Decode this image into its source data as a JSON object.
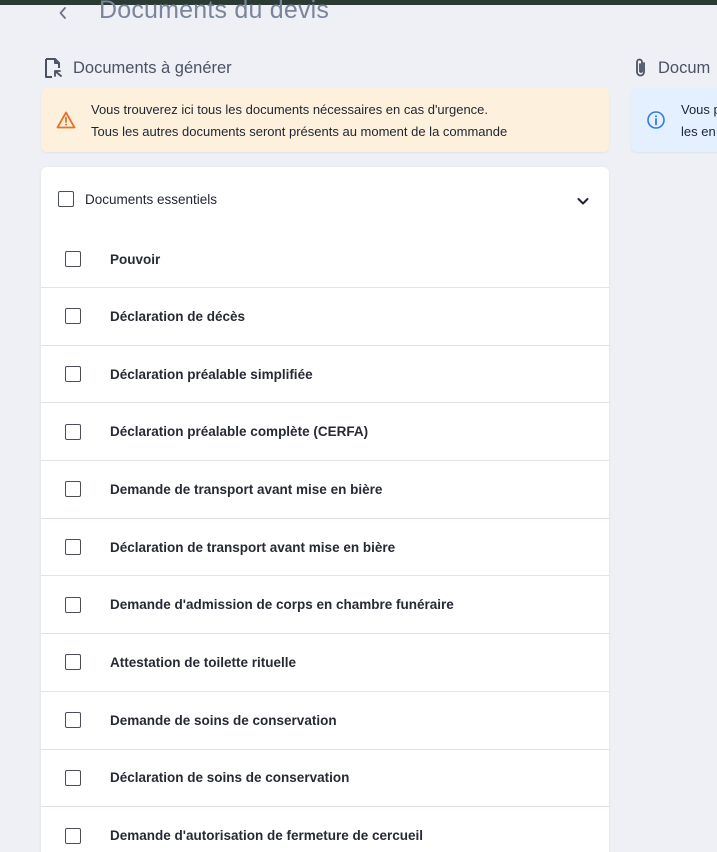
{
  "header": {
    "title": "Documents du devis",
    "back_icon": "chevron-left-icon"
  },
  "sections": {
    "left_title": "Documents à générer",
    "left_icon": "document-generate-icon",
    "right_title": "Docum",
    "right_icon": "paperclip-icon"
  },
  "alerts": {
    "warning": {
      "icon": "warning-triangle-icon",
      "color": "#e8712b",
      "line1": "Vous trouverez ici tous les documents nécessaires en cas d'urgence.",
      "line2": "Tous les autres documents seront présents au moment de la commande"
    },
    "info": {
      "icon": "info-circle-icon",
      "color": "#2f7de1",
      "line1": "Vous p",
      "line2": "les en"
    }
  },
  "group": {
    "label": "Documents essentiels",
    "checked": false,
    "expanded": true
  },
  "documents": [
    {
      "label": "Pouvoir",
      "checked": false
    },
    {
      "label": "Déclaration de décès",
      "checked": false
    },
    {
      "label": "Déclaration préalable simplifiée",
      "checked": false
    },
    {
      "label": "Déclaration préalable complète (CERFA)",
      "checked": false
    },
    {
      "label": "Demande de transport avant mise en bière",
      "checked": false
    },
    {
      "label": "Déclaration de transport avant mise en bière",
      "checked": false
    },
    {
      "label": "Demande d'admission de corps en chambre funéraire",
      "checked": false
    },
    {
      "label": "Attestation de toilette rituelle",
      "checked": false
    },
    {
      "label": "Demande de soins de conservation",
      "checked": false
    },
    {
      "label": "Déclaration de soins de conservation",
      "checked": false
    },
    {
      "label": "Demande d'autorisation de fermeture de cercueil",
      "checked": false
    }
  ]
}
